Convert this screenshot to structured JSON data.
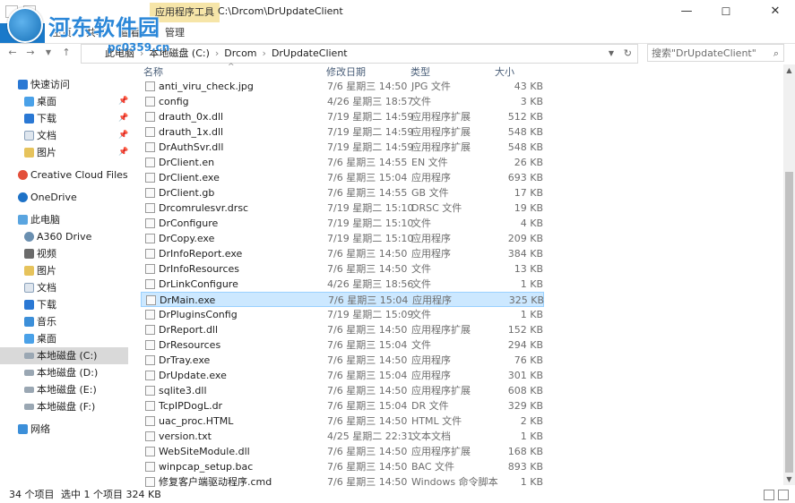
{
  "window": {
    "title": "C:\\Drcom\\DrUpdateClient",
    "context_tab": "应用程序工具",
    "minimize": "—",
    "maximize": "☐",
    "close": "✕"
  },
  "watermark": {
    "text": "河东软件园",
    "sub": "pc0359.cn"
  },
  "ribbon": {
    "tabs": [
      "主页",
      "共享",
      "查看",
      "管理"
    ]
  },
  "address": {
    "crumbs": [
      "此电脑",
      "本地磁盘 (C:)",
      "Drcom",
      "DrUpdateClient"
    ],
    "search_placeholder": "搜索\"DrUpdateClient\""
  },
  "columns": {
    "name": "名称",
    "date": "修改日期",
    "type": "类型",
    "size": "大小"
  },
  "nav": {
    "quick_access": "快速访问",
    "desktop": "桌面",
    "downloads": "下载",
    "documents": "文档",
    "pictures": "图片",
    "creative_cloud": "Creative Cloud Files",
    "onedrive": "OneDrive",
    "this_pc": "此电脑",
    "a360": "A360 Drive",
    "videos": "视频",
    "pictures2": "图片",
    "documents2": "文档",
    "downloads2": "下载",
    "music": "音乐",
    "desktop2": "桌面",
    "drive_c": "本地磁盘 (C:)",
    "drive_d": "本地磁盘 (D:)",
    "drive_e": "本地磁盘 (E:)",
    "drive_f": "本地磁盘 (F:)",
    "network": "网络"
  },
  "files": [
    {
      "name": "anti_viru_check.jpg",
      "date": "7/6 星期三 14:50",
      "type": "JPG 文件",
      "size": "43 KB"
    },
    {
      "name": "config",
      "date": "4/26 星期三 18:57",
      "type": "文件",
      "size": "3 KB"
    },
    {
      "name": "drauth_0x.dll",
      "date": "7/19 星期二 14:59",
      "type": "应用程序扩展",
      "size": "512 KB"
    },
    {
      "name": "drauth_1x.dll",
      "date": "7/19 星期二 14:59",
      "type": "应用程序扩展",
      "size": "548 KB"
    },
    {
      "name": "DrAuthSvr.dll",
      "date": "7/19 星期二 14:59",
      "type": "应用程序扩展",
      "size": "548 KB"
    },
    {
      "name": "DrClient.en",
      "date": "7/6 星期三 14:55",
      "type": "EN 文件",
      "size": "26 KB"
    },
    {
      "name": "DrClient.exe",
      "date": "7/6 星期三 15:04",
      "type": "应用程序",
      "size": "693 KB"
    },
    {
      "name": "DrClient.gb",
      "date": "7/6 星期三 14:55",
      "type": "GB 文件",
      "size": "17 KB"
    },
    {
      "name": "Drcomrulesvr.drsc",
      "date": "7/19 星期二 15:10",
      "type": "DRSC 文件",
      "size": "19 KB"
    },
    {
      "name": "DrConfigure",
      "date": "7/19 星期二 15:10",
      "type": "文件",
      "size": "4 KB"
    },
    {
      "name": "DrCopy.exe",
      "date": "7/19 星期二 15:10",
      "type": "应用程序",
      "size": "209 KB"
    },
    {
      "name": "DrInfoReport.exe",
      "date": "7/6 星期三 14:50",
      "type": "应用程序",
      "size": "384 KB"
    },
    {
      "name": "DrInfoResources",
      "date": "7/6 星期三 14:50",
      "type": "文件",
      "size": "13 KB"
    },
    {
      "name": "DrLinkConfigure",
      "date": "4/26 星期三 18:56",
      "type": "文件",
      "size": "1 KB"
    },
    {
      "name": "DrMain.exe",
      "date": "7/6 星期三 15:04",
      "type": "应用程序",
      "size": "325 KB"
    },
    {
      "name": "DrPluginsConfig",
      "date": "7/19 星期二 15:09",
      "type": "文件",
      "size": "1 KB"
    },
    {
      "name": "DrReport.dll",
      "date": "7/6 星期三 14:50",
      "type": "应用程序扩展",
      "size": "152 KB"
    },
    {
      "name": "DrResources",
      "date": "7/6 星期三 15:04",
      "type": "文件",
      "size": "294 KB"
    },
    {
      "name": "DrTray.exe",
      "date": "7/6 星期三 14:50",
      "type": "应用程序",
      "size": "76 KB"
    },
    {
      "name": "DrUpdate.exe",
      "date": "7/6 星期三 15:04",
      "type": "应用程序",
      "size": "301 KB"
    },
    {
      "name": "sqlite3.dll",
      "date": "7/6 星期三 14:50",
      "type": "应用程序扩展",
      "size": "608 KB"
    },
    {
      "name": "TcpIPDogL.dr",
      "date": "7/6 星期三 15:04",
      "type": "DR 文件",
      "size": "329 KB"
    },
    {
      "name": "uac_proc.HTML",
      "date": "7/6 星期三 14:50",
      "type": "HTML 文件",
      "size": "2 KB"
    },
    {
      "name": "version.txt",
      "date": "4/25 星期二 22:31",
      "type": "文本文档",
      "size": "1 KB"
    },
    {
      "name": "WebSiteModule.dll",
      "date": "7/6 星期三 14:50",
      "type": "应用程序扩展",
      "size": "168 KB"
    },
    {
      "name": "winpcap_setup.bac",
      "date": "7/6 星期三 14:50",
      "type": "BAC 文件",
      "size": "893 KB"
    },
    {
      "name": "修复客户端驱动程序.cmd",
      "date": "7/6 星期三 14:50",
      "type": "Windows 命令脚本",
      "size": "1 KB"
    }
  ],
  "status": {
    "count": "34 个项目",
    "selection": "选中 1 个项目  324 KB"
  },
  "colors": {
    "selection": "#cce8ff",
    "accent": "#1979ca"
  }
}
